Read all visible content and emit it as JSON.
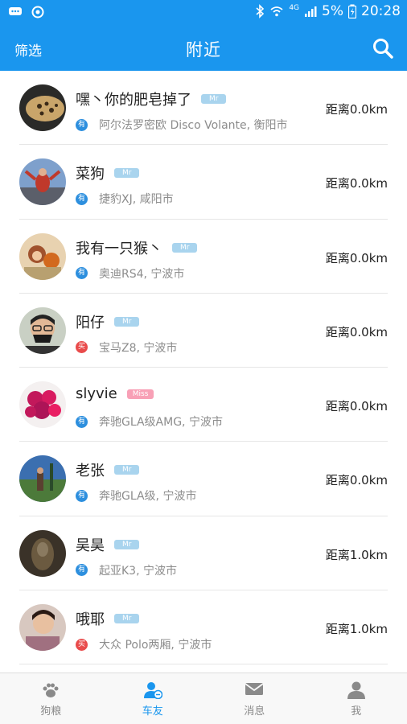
{
  "status_bar": {
    "battery": "5%",
    "time": "20:28",
    "network": "4G",
    "icons": [
      "chat-icon",
      "sync-icon",
      "bluetooth-icon",
      "wifi-icon",
      "signal-icon",
      "battery-icon"
    ]
  },
  "header": {
    "filter_label": "筛选",
    "title": "附近",
    "search_icon": "search-icon"
  },
  "users": [
    {
      "name": "嘿丶你的肥皂掉了",
      "badge": "Mr",
      "tag": "有",
      "tag_type": "have",
      "car": "阿尔法罗密欧 Disco Volante, 衡阳市",
      "distance": "距离0.0km"
    },
    {
      "name": "菜狗",
      "badge": "Mr",
      "tag": "有",
      "tag_type": "have",
      "car": "捷豹XJ, 咸阳市",
      "distance": "距离0.0km"
    },
    {
      "name": "我有一只猴丶",
      "badge": "Mr",
      "tag": "有",
      "tag_type": "have",
      "car": "奥迪RS4, 宁波市",
      "distance": "距离0.0km"
    },
    {
      "name": "阳仔",
      "badge": "Mr",
      "tag": "买",
      "tag_type": "buy",
      "car": "宝马Z8, 宁波市",
      "distance": "距离0.0km"
    },
    {
      "name": "slyvie",
      "badge": "Miss",
      "tag": "有",
      "tag_type": "have",
      "car": "奔驰GLA级AMG, 宁波市",
      "distance": "距离0.0km"
    },
    {
      "name": "老张",
      "badge": "Mr",
      "tag": "有",
      "tag_type": "have",
      "car": "奔驰GLA级, 宁波市",
      "distance": "距离0.0km"
    },
    {
      "name": "吴昊",
      "badge": "Mr",
      "tag": "有",
      "tag_type": "have",
      "car": "起亚K3, 宁波市",
      "distance": "距离1.0km"
    },
    {
      "name": "哦耶",
      "badge": "Mr",
      "tag": "买",
      "tag_type": "buy",
      "car": "大众 Polo两厢, 宁波市",
      "distance": "距离1.0km"
    }
  ],
  "tabs": [
    {
      "label": "狗粮",
      "icon": "paw-icon",
      "active": false
    },
    {
      "label": "车友",
      "icon": "friends-icon",
      "active": true
    },
    {
      "label": "消息",
      "icon": "mail-icon",
      "active": false
    },
    {
      "label": "我",
      "icon": "person-icon",
      "active": false
    }
  ],
  "colors": {
    "primary": "#1a96ee",
    "badge_mr": "#a9d4ee",
    "badge_miss": "#f8a0b6",
    "tag_have": "#2d8fde",
    "tag_buy": "#e94b4b"
  }
}
